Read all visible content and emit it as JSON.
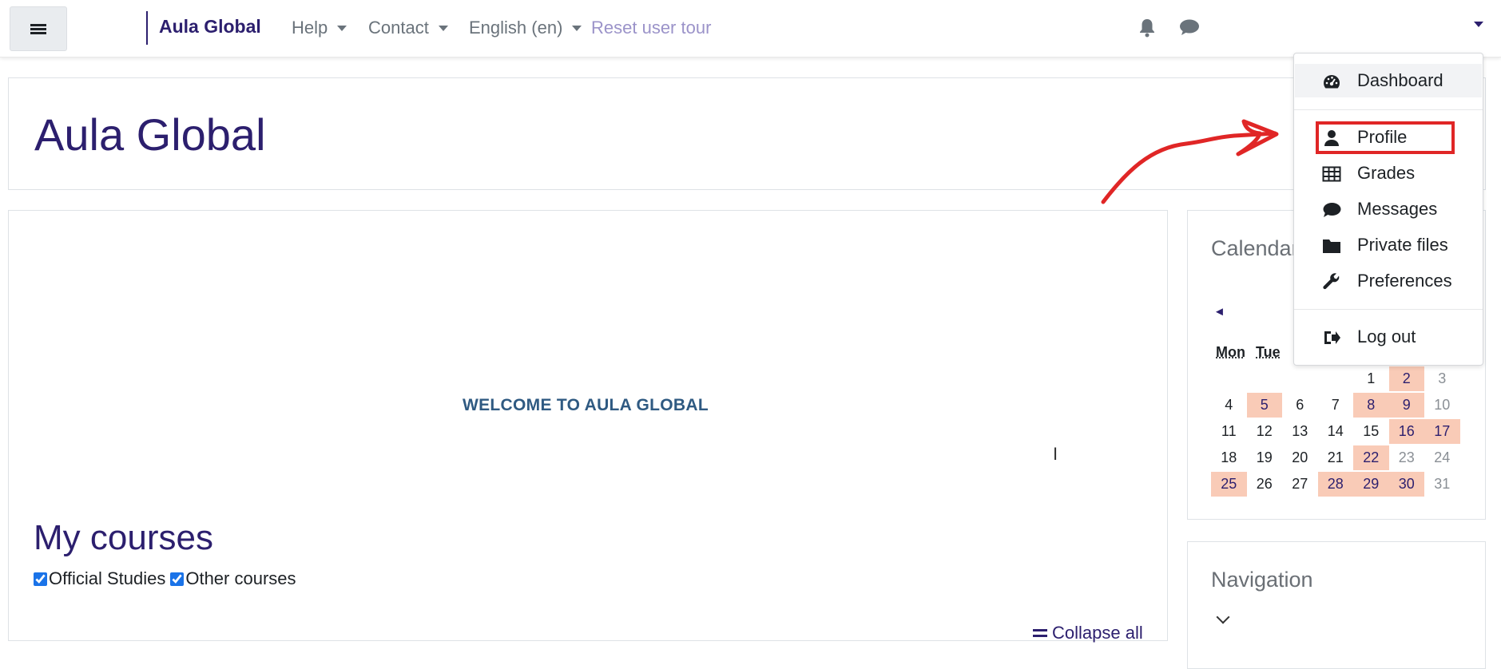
{
  "navbar": {
    "menu_icon": "hamburger-icon",
    "brand": "Aula Global",
    "links": [
      {
        "label": "Help",
        "has_caret": true
      },
      {
        "label": "Contact",
        "has_caret": true
      },
      {
        "label": "English ‎(en)‎",
        "has_caret": true
      },
      {
        "label": "Reset user tour",
        "has_caret": false
      }
    ],
    "icons": [
      "bell-icon",
      "chat-icon"
    ]
  },
  "header": {
    "title": "Aula Global"
  },
  "main": {
    "welcome": "WELCOME TO AULA GLOBAL",
    "cursor_mark": "I",
    "my_courses_title": "My courses",
    "filters": [
      {
        "label": "Official Studies",
        "checked": true
      },
      {
        "label": "Other courses",
        "checked": true
      }
    ],
    "collapse_all": "Collapse all"
  },
  "calendar": {
    "title": "Calendar",
    "prev_arrow": "◄",
    "day_headers": [
      "Mon",
      "Tue"
    ],
    "weeks": [
      [
        {
          "d": ""
        },
        {
          "d": ""
        },
        {
          "d": ""
        },
        {
          "d": ""
        },
        {
          "d": "1"
        },
        {
          "d": "2",
          "ev": true,
          "we": true
        },
        {
          "d": "3",
          "we": true
        }
      ],
      [
        {
          "d": "4"
        },
        {
          "d": "5",
          "ev": true
        },
        {
          "d": "6"
        },
        {
          "d": "7"
        },
        {
          "d": "8",
          "ev": true
        },
        {
          "d": "9",
          "ev": true,
          "we": true
        },
        {
          "d": "10",
          "we": true
        }
      ],
      [
        {
          "d": "11"
        },
        {
          "d": "12"
        },
        {
          "d": "13"
        },
        {
          "d": "14"
        },
        {
          "d": "15"
        },
        {
          "d": "16",
          "ev": true,
          "we": true
        },
        {
          "d": "17",
          "ev": true,
          "we": true
        }
      ],
      [
        {
          "d": "18"
        },
        {
          "d": "19"
        },
        {
          "d": "20"
        },
        {
          "d": "21"
        },
        {
          "d": "22",
          "ev": true
        },
        {
          "d": "23",
          "we": true
        },
        {
          "d": "24",
          "we": true
        }
      ],
      [
        {
          "d": "25",
          "ev": true
        },
        {
          "d": "26"
        },
        {
          "d": "27"
        },
        {
          "d": "28",
          "ev": true
        },
        {
          "d": "29",
          "ev": true
        },
        {
          "d": "30",
          "ev": true,
          "we": true
        },
        {
          "d": "31",
          "we": true
        }
      ]
    ]
  },
  "navigation_block": {
    "title": "Navigation"
  },
  "user_menu": {
    "items": [
      {
        "label": "Dashboard",
        "icon": "dashboard-icon"
      },
      {
        "label": "Profile",
        "icon": "user-icon"
      },
      {
        "label": "Grades",
        "icon": "table-icon"
      },
      {
        "label": "Messages",
        "icon": "chat-icon"
      },
      {
        "label": "Private files",
        "icon": "folder-icon"
      },
      {
        "label": "Preferences",
        "icon": "wrench-icon"
      },
      {
        "label": "Log out",
        "icon": "logout-icon"
      }
    ]
  },
  "colors": {
    "brand": "#2c1f6e",
    "event_day": "#f9cbb7",
    "annotation": "#e02626"
  }
}
